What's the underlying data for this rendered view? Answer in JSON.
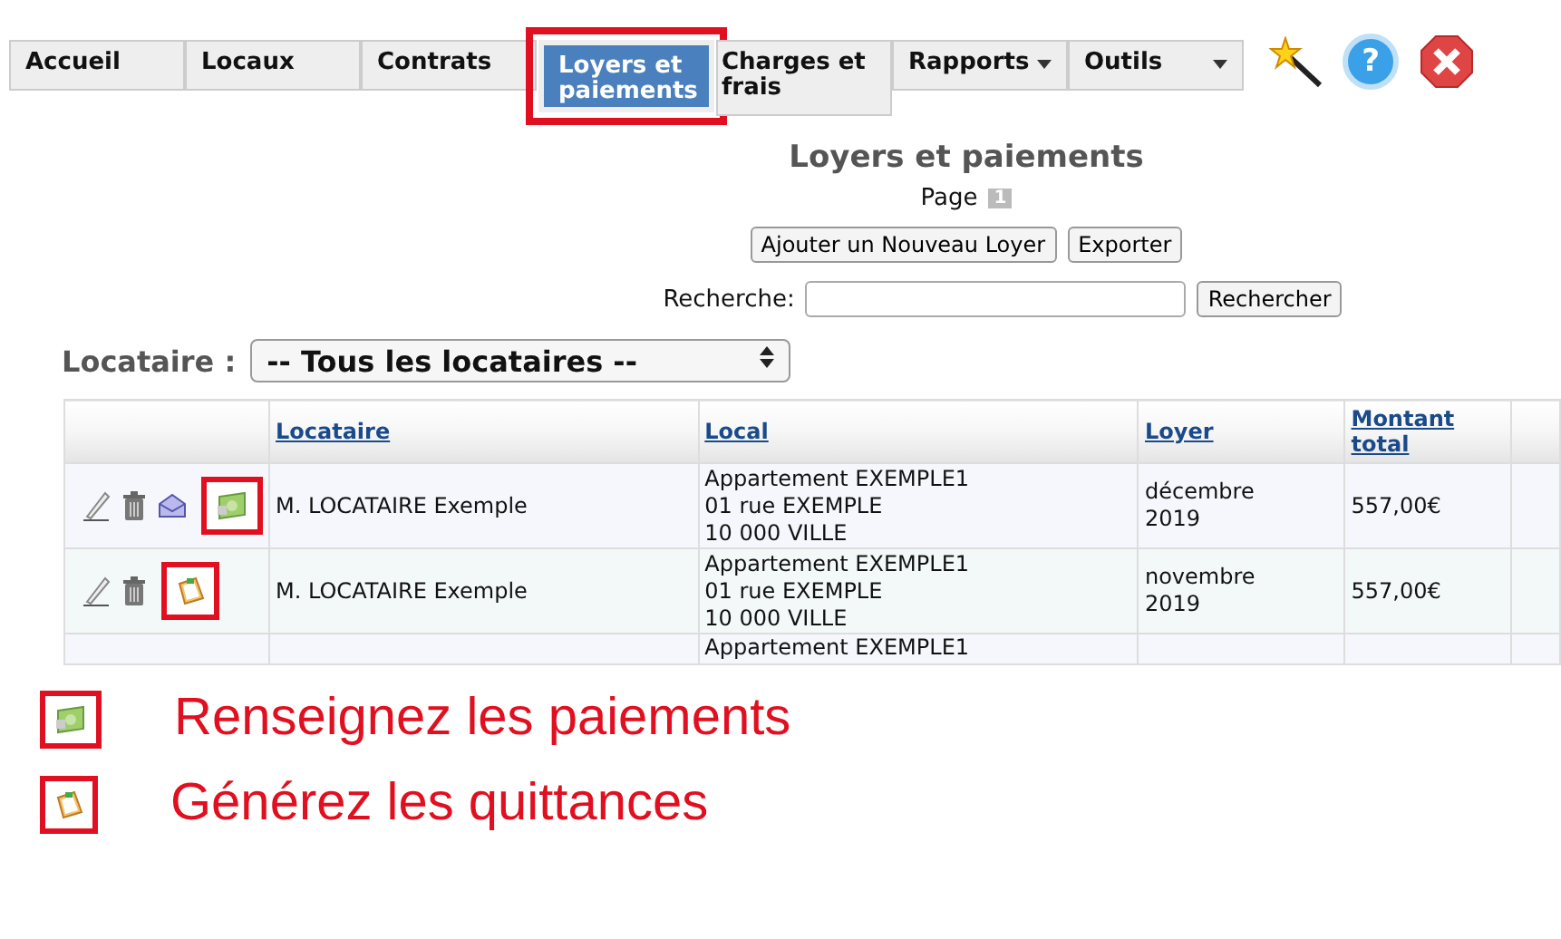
{
  "nav": {
    "tabs": [
      {
        "label": "Accueil",
        "selected": false,
        "dropdown": false,
        "highlighted": false
      },
      {
        "label": "Locaux",
        "selected": false,
        "dropdown": false,
        "highlighted": false
      },
      {
        "label": "Contrats",
        "selected": false,
        "dropdown": false,
        "highlighted": false
      },
      {
        "label": "Loyers et paiements",
        "selected": true,
        "dropdown": false,
        "highlighted": true
      },
      {
        "label": "Charges et frais",
        "selected": false,
        "dropdown": false,
        "highlighted": false
      },
      {
        "label": "Rapports",
        "selected": false,
        "dropdown": true,
        "highlighted": false
      },
      {
        "label": "Outils",
        "selected": false,
        "dropdown": true,
        "highlighted": false
      }
    ],
    "tools": [
      {
        "kind": "wand"
      },
      {
        "kind": "help",
        "label": "?"
      },
      {
        "kind": "close"
      }
    ]
  },
  "title": "Loyers et paiements",
  "pager": {
    "label": "Page",
    "pages": [
      {
        "label": "1",
        "selected": true
      }
    ]
  },
  "buttons": [
    "Ajouter un Nouveau Loyer",
    "Exporter"
  ],
  "search": {
    "label": "Recherche:",
    "button": "Rechercher"
  },
  "filter": {
    "label": "Locataire :",
    "value": "-- Tous les locataires --"
  },
  "table": {
    "columns": [
      "Locataire",
      "Local",
      "Loyer",
      "Montant total"
    ],
    "rows": [
      {
        "actions": [
          {
            "kind": "edit",
            "highlighted": false
          },
          {
            "kind": "delete",
            "highlighted": false
          },
          {
            "kind": "mail",
            "highlighted": false
          },
          {
            "kind": "money",
            "highlighted": true
          }
        ],
        "cells": [
          "M. LOCATAIRE Exemple",
          "Appartement EXEMPLE1\n01 rue EXEMPLE\n10 000 VILLE",
          "décembre\n2019",
          "557,00€"
        ]
      },
      {
        "actions": [
          {
            "kind": "edit",
            "highlighted": false
          },
          {
            "kind": "delete",
            "highlighted": false
          },
          {
            "kind": "receipt",
            "highlighted": true
          }
        ],
        "cells": [
          "M. LOCATAIRE Exemple",
          "Appartement EXEMPLE1\n01 rue EXEMPLE\n10 000 VILLE",
          "novembre\n2019",
          "557,00€"
        ]
      },
      {
        "actions": [],
        "cells": [
          "",
          "Appartement EXEMPLE1",
          "",
          ""
        ]
      }
    ]
  },
  "legend": [
    {
      "kind": "money",
      "text": "Renseignez les paiements"
    },
    {
      "kind": "receipt",
      "text": "Générez les quittances"
    }
  ]
}
